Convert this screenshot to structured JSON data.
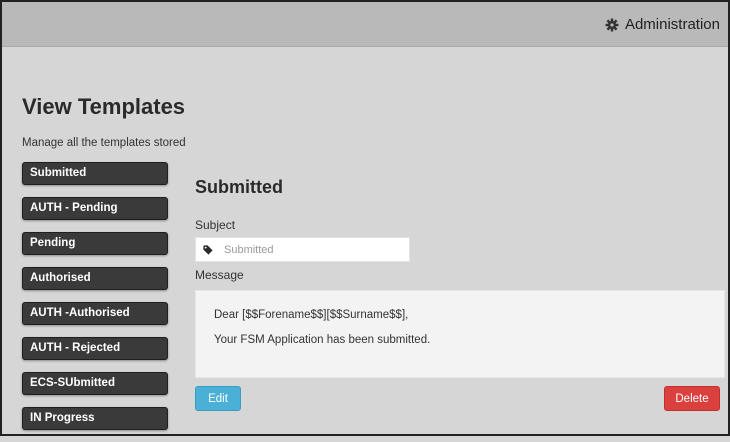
{
  "header": {
    "admin_label": "Administration",
    "admin_icon": "gear-icon"
  },
  "page": {
    "title": "View Templates",
    "subtitle": "Manage all the templates stored"
  },
  "sidebar": {
    "items": [
      {
        "label": "Submitted"
      },
      {
        "label": "AUTH - Pending"
      },
      {
        "label": "Pending"
      },
      {
        "label": "Authorised"
      },
      {
        "label": "AUTH -Authorised"
      },
      {
        "label": "AUTH - Rejected"
      },
      {
        "label": "ECS-SUbmitted"
      },
      {
        "label": "IN Progress"
      }
    ]
  },
  "template": {
    "title": "Submitted",
    "subject_label": "Subject",
    "subject_placeholder": "Submitted",
    "subject_icon": "tag-icon",
    "message_label": "Message",
    "message_lines": [
      "Dear [$$Forename$$][$$Surname$$],",
      "Your FSM Application has been submitted."
    ]
  },
  "actions": {
    "edit_label": "Edit",
    "delete_label": "Delete"
  },
  "colors": {
    "background": "#d6d6d6",
    "topbar": "#b9b9b9",
    "sidebar_button": "#3a3a3a",
    "edit_button": "#4bb0d5",
    "delete_button": "#d9403e"
  }
}
